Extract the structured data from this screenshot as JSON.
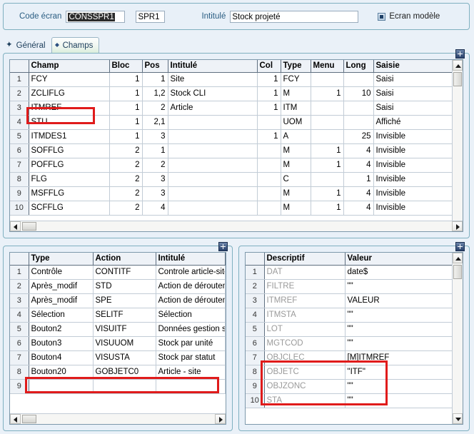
{
  "header": {
    "code_label": "Code écran",
    "code_value": "CONSSPR1",
    "spr_value": "SPR1",
    "intitule_label": "Intitulé",
    "intitule_value": "Stock projeté",
    "ecran_modele_label": "Ecran modèle"
  },
  "tabs": [
    {
      "label": "Général",
      "active": false
    },
    {
      "label": "Champs",
      "active": true
    }
  ],
  "fields_grid": {
    "columns": [
      "Champ",
      "Bloc",
      "Pos",
      "Intitulé",
      "Col",
      "Type",
      "Menu",
      "Long",
      "Saisie"
    ],
    "rows": [
      {
        "n": "1",
        "champ": "FCY",
        "bloc": "1",
        "pos": "1",
        "intitule": "Site",
        "col": "1",
        "type": "FCY",
        "menu": "",
        "long": "",
        "saisie": "Saisi"
      },
      {
        "n": "2",
        "champ": "ZCLIFLG",
        "bloc": "1",
        "pos": "1,2",
        "intitule": "Stock CLI",
        "col": "1",
        "type": "M",
        "menu": "1",
        "long": "10",
        "saisie": "Saisi"
      },
      {
        "n": "3",
        "champ": "ITMREF",
        "bloc": "1",
        "pos": "2",
        "intitule": "Article",
        "col": "1",
        "type": "ITM",
        "menu": "",
        "long": "",
        "saisie": "Saisi"
      },
      {
        "n": "4",
        "champ": "STU",
        "bloc": "1",
        "pos": "2,1",
        "intitule": "",
        "col": "",
        "type": "UOM",
        "menu": "",
        "long": "",
        "saisie": "Affiché"
      },
      {
        "n": "5",
        "champ": "ITMDES1",
        "bloc": "1",
        "pos": "3",
        "intitule": "",
        "col": "1",
        "type": "A",
        "menu": "",
        "long": "25",
        "saisie": "Invisible"
      },
      {
        "n": "6",
        "champ": "SOFFLG",
        "bloc": "2",
        "pos": "1",
        "intitule": "",
        "col": "",
        "type": "M",
        "menu": "1",
        "long": "4",
        "saisie": "Invisible"
      },
      {
        "n": "7",
        "champ": "POFFLG",
        "bloc": "2",
        "pos": "2",
        "intitule": "",
        "col": "",
        "type": "M",
        "menu": "1",
        "long": "4",
        "saisie": "Invisible"
      },
      {
        "n": "8",
        "champ": "FLG",
        "bloc": "2",
        "pos": "3",
        "intitule": "",
        "col": "",
        "type": "C",
        "menu": "",
        "long": "1",
        "saisie": "Invisible"
      },
      {
        "n": "9",
        "champ": "MSFFLG",
        "bloc": "2",
        "pos": "3",
        "intitule": "",
        "col": "",
        "type": "M",
        "menu": "1",
        "long": "4",
        "saisie": "Invisible"
      },
      {
        "n": "10",
        "champ": "SCFFLG",
        "bloc": "2",
        "pos": "4",
        "intitule": "",
        "col": "",
        "type": "M",
        "menu": "1",
        "long": "4",
        "saisie": "Invisible"
      }
    ]
  },
  "actions_grid": {
    "columns": [
      "Type",
      "Action",
      "Intitulé"
    ],
    "rows": [
      {
        "n": "1",
        "type": "Contrôle",
        "action": "CONTITF",
        "intitule": "Controle article-site"
      },
      {
        "n": "2",
        "type": "Après_modif",
        "action": "STD",
        "intitule": "Action de déroutement"
      },
      {
        "n": "3",
        "type": "Après_modif",
        "action": "SPE",
        "intitule": "Action de déroutement"
      },
      {
        "n": "4",
        "type": "Sélection",
        "action": "SELITF",
        "intitule": "Sélection"
      },
      {
        "n": "5",
        "type": "Bouton2",
        "action": "VISUITF",
        "intitule": "Données gestion stock"
      },
      {
        "n": "6",
        "type": "Bouton3",
        "action": "VISUUOM",
        "intitule": "Stock par unité"
      },
      {
        "n": "7",
        "type": "Bouton4",
        "action": "VISUSTA",
        "intitule": "Stock par statut"
      },
      {
        "n": "8",
        "type": "Bouton20",
        "action": "GOBJETC0",
        "intitule": "Article - site"
      },
      {
        "n": "9",
        "type": "",
        "action": "",
        "intitule": ""
      }
    ]
  },
  "params_grid": {
    "columns": [
      "Descriptif",
      "Valeur"
    ],
    "rows": [
      {
        "n": "1",
        "descriptif": "DAT",
        "valeur": "date$"
      },
      {
        "n": "2",
        "descriptif": "FILTRE",
        "valeur": "\"\""
      },
      {
        "n": "3",
        "descriptif": "ITMREF",
        "valeur": "VALEUR"
      },
      {
        "n": "4",
        "descriptif": "ITMSTA",
        "valeur": "\"\""
      },
      {
        "n": "5",
        "descriptif": "LOT",
        "valeur": "\"\""
      },
      {
        "n": "6",
        "descriptif": "MGTCOD",
        "valeur": "\"\""
      },
      {
        "n": "7",
        "descriptif": "OBJCLEC",
        "valeur": "[M]ITMREF"
      },
      {
        "n": "8",
        "descriptif": "OBJETC",
        "valeur": "\"ITF\""
      },
      {
        "n": "9",
        "descriptif": "OBJZONC",
        "valeur": "\"\""
      },
      {
        "n": "10",
        "descriptif": "STA",
        "valeur": "\"\""
      }
    ]
  },
  "colors": {
    "highlight_green": "#c3ec7e",
    "highlight_cyan": "#7ff0f5",
    "annotation_red": "#e01b1b",
    "panel_border": "#7fb0c0",
    "background": "#eaf1f8"
  },
  "icons": {
    "plus": "plus-icon",
    "scroll_up": "chevron-up-icon",
    "scroll_down": "chevron-down-icon",
    "scroll_left": "chevron-left-icon",
    "scroll_right": "chevron-right-icon"
  }
}
